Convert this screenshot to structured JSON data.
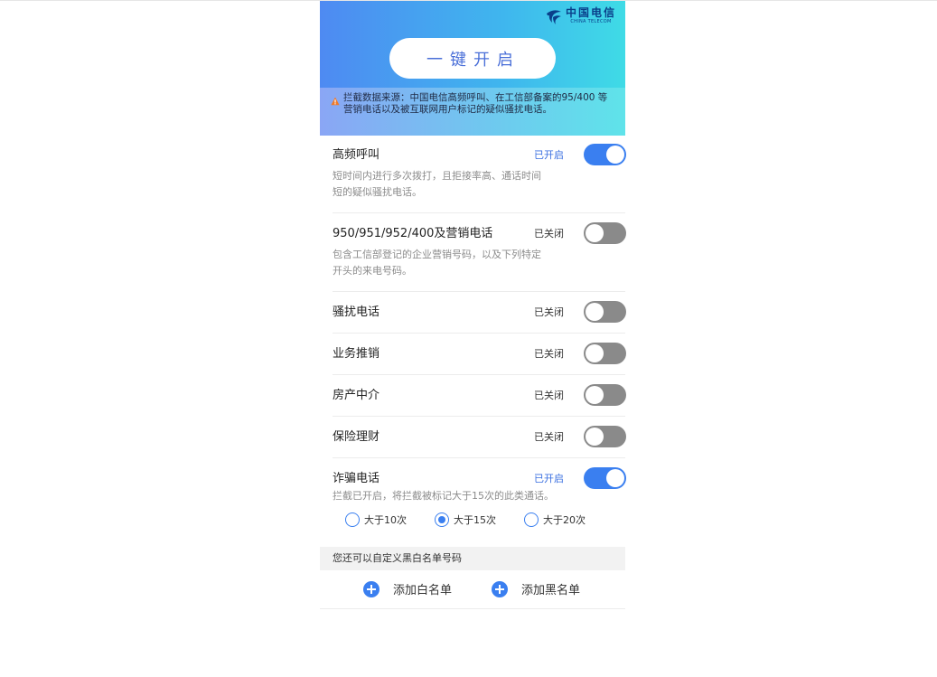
{
  "brand": {
    "name_cn": "中国电信",
    "name_en": "CHINA TELECOM",
    "icon": "telecom-logo-icon"
  },
  "hero": {
    "one_key_label": "一键开启"
  },
  "notice": {
    "icon": "warning-icon",
    "text": "拦截数据来源：中国电信高频呼叫、在工信部备案的95/400 等营销电话以及被互联网用户标记的疑似骚扰电话。"
  },
  "items": [
    {
      "title": "高频呼叫",
      "status": "已开启",
      "enabled": true,
      "desc": "短时间内进行多次拨打，且拒接率高、通话时间短的疑似骚扰电话。"
    },
    {
      "title": "950/951/952/400及营销电话",
      "status": "已关闭",
      "enabled": false,
      "desc": "包含工信部登记的企业营销号码，以及下列特定开头的来电号码。"
    },
    {
      "title": "骚扰电话",
      "status": "已关闭",
      "enabled": false
    },
    {
      "title": "业务推销",
      "status": "已关闭",
      "enabled": false
    },
    {
      "title": "房产中介",
      "status": "已关闭",
      "enabled": false
    },
    {
      "title": "保险理财",
      "status": "已关闭",
      "enabled": false
    },
    {
      "title": "诈骗电话",
      "status": "已开启",
      "enabled": true,
      "desc": "拦截已开启，将拦截被标记大于15次的此类通话。"
    }
  ],
  "threshold": {
    "options": [
      "大于10次",
      "大于15次",
      "大于20次"
    ],
    "selected": "大于15次"
  },
  "lists": {
    "header": "您还可以自定义黑白名单号码",
    "add_whitelist": "添加白名单",
    "add_blacklist": "添加黑名单"
  },
  "colors": {
    "accent": "#3a7ff0",
    "switch_off": "#8a8a8a",
    "status_on": "#3a6fe0"
  }
}
